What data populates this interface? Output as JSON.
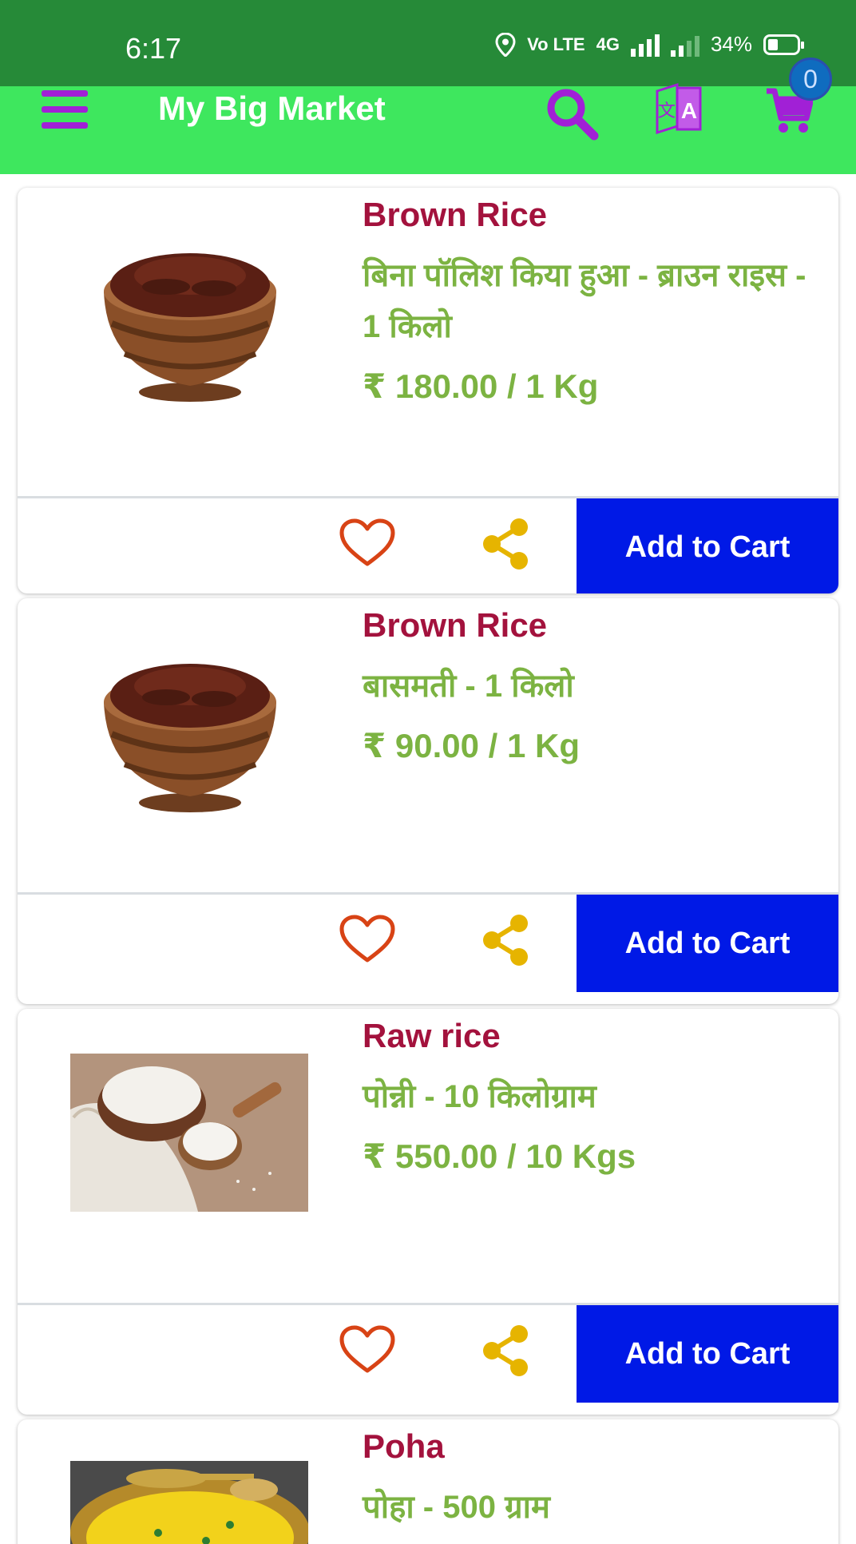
{
  "status_bar": {
    "time": "6:17",
    "volte_label": "Vo LTE",
    "network_label": "4G",
    "battery_percent": "34%"
  },
  "app_bar": {
    "title": "My Big Market",
    "cart_count": "0"
  },
  "colors": {
    "status_bar": "#268a38",
    "app_bar": "#3ee75e",
    "accent_purple": "#a120d6",
    "product_name": "#a3123d",
    "product_text": "#7cb342",
    "add_to_cart": "#0019e6",
    "heart": "#d84315",
    "share": "#e6b400"
  },
  "products": [
    {
      "name": "Brown Rice",
      "desc": "बिना पॉलिश किया हुआ - ब्राउन राइस - 1 किलो",
      "price": "₹ 180.00 / 1 Kg",
      "image": "brown-rice-bowl-image",
      "add_to_cart_label": "Add to Cart"
    },
    {
      "name": "Brown Rice",
      "desc": "बासमती - 1 किलो",
      "price": "₹ 90.00 / 1 Kg",
      "image": "brown-rice-bowl-image",
      "add_to_cart_label": "Add to Cart"
    },
    {
      "name": "Raw rice",
      "desc": "पोन्नी - 10 किलोग्राम",
      "price": "₹ 550.00 / 10 Kgs",
      "image": "raw-rice-photo",
      "add_to_cart_label": "Add to Cart"
    },
    {
      "name": "Poha",
      "desc": "पोहा - 500 ग्राम",
      "image": "poha-photo"
    }
  ]
}
